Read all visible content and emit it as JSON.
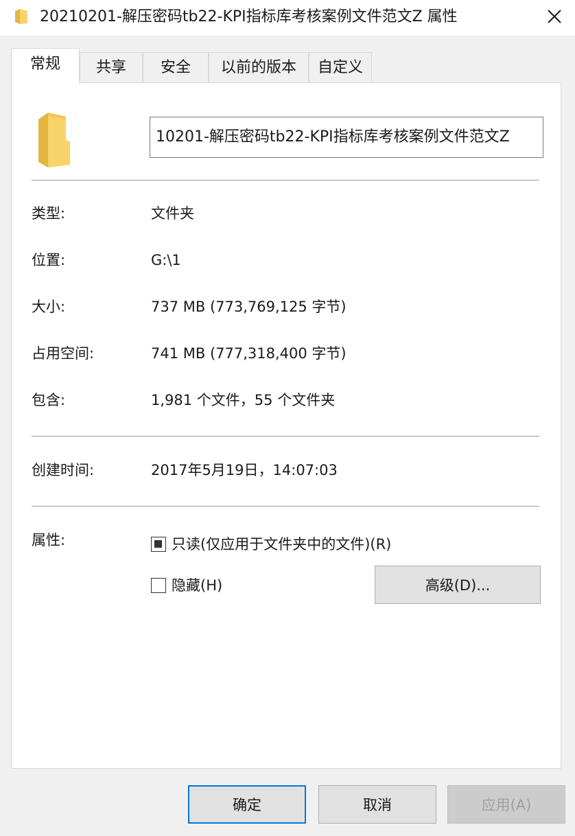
{
  "window": {
    "title": "20210201-解压密码tb22-KPI指标库考核案例文件范文Z 属性",
    "close_icon": "close-icon"
  },
  "tabs": [
    {
      "label": "常规",
      "active": true
    },
    {
      "label": "共享"
    },
    {
      "label": "安全"
    },
    {
      "label": "以前的版本"
    },
    {
      "label": "自定义"
    }
  ],
  "general": {
    "folder_name": "10201-解压密码tb22-KPI指标库考核案例文件范文Z",
    "type_label": "类型:",
    "type_value": "文件夹",
    "location_label": "位置:",
    "location_value": "G:\\1",
    "size_label": "大小:",
    "size_value": "737 MB (773,769,125 字节)",
    "size_on_disk_label": "占用空间:",
    "size_on_disk_value": "741 MB (777,318,400 字节)",
    "contains_label": "包含:",
    "contains_value": "1,981 个文件，55 个文件夹",
    "created_label": "创建时间:",
    "created_value": "2017年5月19日，14:07:03",
    "attributes_label": "属性:",
    "readonly_label": "只读(仅应用于文件夹中的文件)(R)",
    "readonly_state": "indeterminate",
    "hidden_label": "隐藏(H)",
    "hidden_state": "unchecked",
    "advanced_button": "高级(D)..."
  },
  "footer": {
    "ok_label": "确定",
    "cancel_label": "取消",
    "apply_label": "应用(A)"
  },
  "colors": {
    "folder_yellow": "#f8d36a",
    "folder_dark": "#e6b53f",
    "focus_blue": "#0078d7"
  }
}
